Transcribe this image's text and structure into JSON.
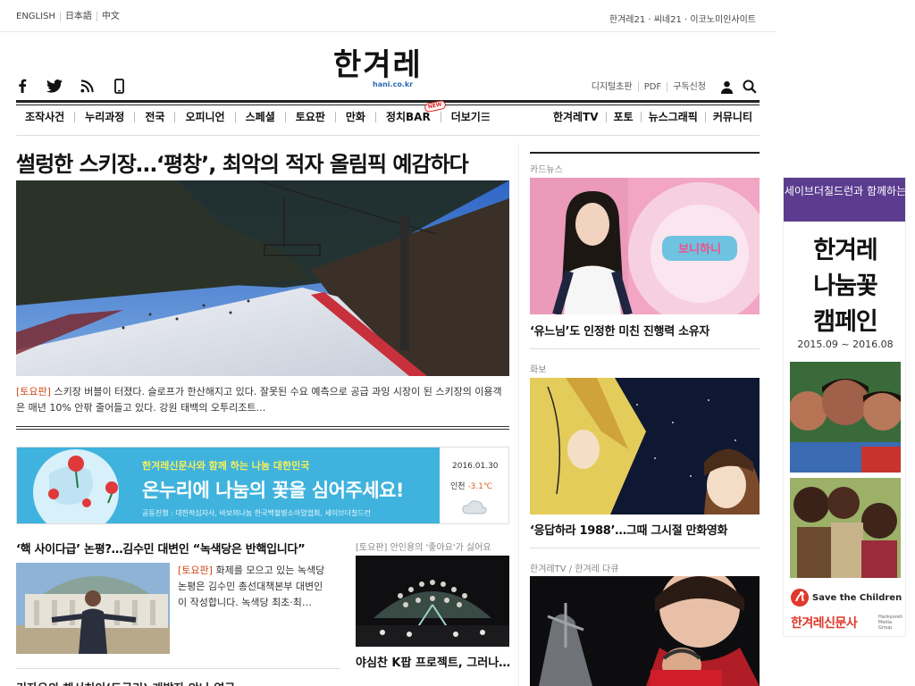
{
  "topbar": {
    "languages": [
      "ENGLISH",
      "日本語",
      "中文"
    ],
    "sites": "한겨레21 · 씨네21 · 이코노미인사이트"
  },
  "masthead": {
    "logo": "한겨레",
    "logo_sub": "hani.co.kr",
    "utilities": [
      "디지털초판",
      "PDF",
      "구독신청"
    ]
  },
  "nav": {
    "left": [
      "조작사건",
      "누리과정",
      "전국",
      "오피니언",
      "스페셜",
      "토요판",
      "만화",
      "정치BAR",
      "더보기☰"
    ],
    "new_badge": "NEW",
    "right": [
      "한겨레TV",
      "포토",
      "뉴스그래픽",
      "커뮤니티"
    ]
  },
  "lead": {
    "headline": "썰렁한 스키장…‘평창’, 최악의 적자 올림픽 예감하다",
    "tag": "[토요판]",
    "summary": " 스키장 버블이 터졌다. 슬로프가 한산해지고 있다. 잘못된 수요 예측으로 공급 과잉 시장이 된 스키장의 이용객은 매년 10% 안팎 줄어들고 있다. 강원 태백의 오투리조트…"
  },
  "banner": {
    "small": "한겨레신문사와 함께 하는 나눔 대한민국",
    "big": "온누리에 나눔의 꽃을 심어주세요!",
    "foot": "공동진행 : 대한적십자사, 바보의나눔  한국백혈병소아암협회, 세이브더칠드런",
    "date": "2016.01.30",
    "location": "인천",
    "temperature": "-3.1℃"
  },
  "story2": {
    "headline": "‘핵 사이다급’ 논평?…김수민 대변인 “녹색당은 반핵입니다”",
    "tag": "[토요판]",
    "text": " 화제를 모으고 있는 녹색당 논평은 김수민 총선대책본부 대변인이 작성합니다. 녹색당 최초·최…",
    "next_headline": "기자유의 해서치이(도구리) 개발자 안나 연구"
  },
  "story3": {
    "caption": "[토요판] 안인용의 '좋아요'가 싫어요",
    "title": "야심찬 K팝 프로젝트, 그러나…"
  },
  "right_column": {
    "card_label": "카드뉴스",
    "card_title": "‘유느님’도 인정한 미친 진행력 소유자",
    "card_sign": "보니하니",
    "photo_label": "화보",
    "photo_title": "‘응답하라 1988’…그때 그시절 만화영화",
    "tv_label": "한겨레TV / 한겨레 다큐"
  },
  "ad": {
    "top": "세이브더칠드런과 함께하는",
    "big": [
      "한겨레",
      "나눔꽃",
      "캠페인"
    ],
    "date": "2015.09 ~ 2016.08",
    "save": "Save the Children",
    "hani": "한겨레신문사",
    "hani_sub": "Hankyoreh Media Group"
  },
  "colors": {
    "tag": "#d04a1c",
    "banner_blue": "#3fb3dd",
    "ad_purple": "#5b3c8f",
    "hani_red": "#e0382b"
  }
}
